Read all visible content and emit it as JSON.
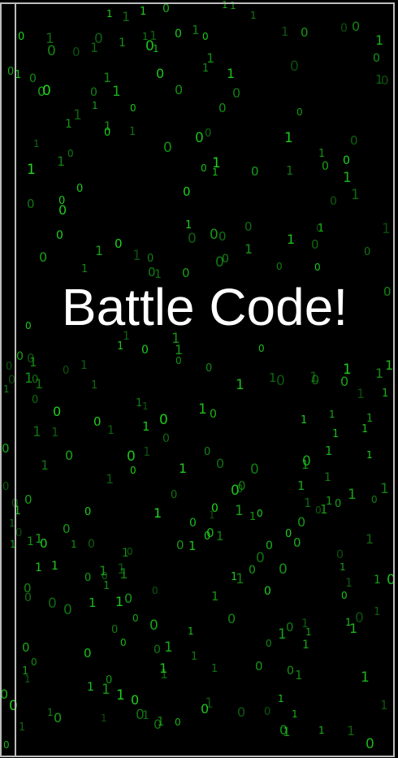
{
  "app": {
    "title": "Battle Code!"
  },
  "background": {
    "effect": "binary-rain",
    "glyphs": [
      "0",
      "1"
    ],
    "glyph_color": "#1fd61f",
    "background_color": "#000000"
  },
  "frame": {
    "border_color": "#bdbdbd"
  },
  "colors": {
    "title_text": "#ffffff"
  }
}
